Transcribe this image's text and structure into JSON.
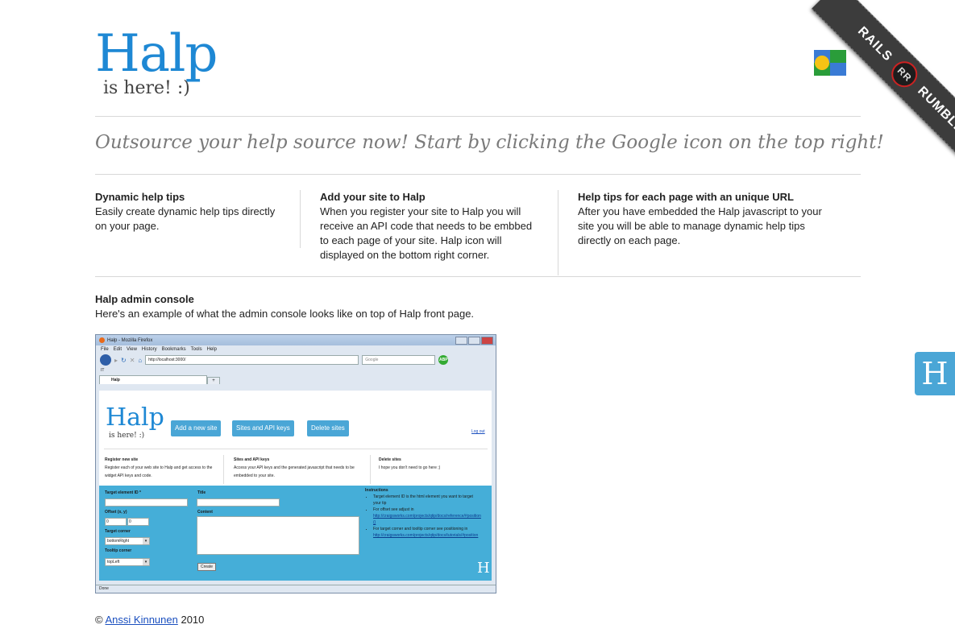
{
  "header": {
    "logo": "Halp",
    "logo_sub": "is here! :)"
  },
  "tagline": "Outsource your help source now! Start by clicking the Google icon on the top right!",
  "features": [
    {
      "title": "Dynamic help tips",
      "body": "Easily create dynamic help tips directly on your page."
    },
    {
      "title": "Add your site to Halp",
      "body": "When you register your site to Halp you will receive an API code that needs to be embbed to each page of your site. Halp icon will displayed on the bottom right corner."
    },
    {
      "title": "Help tips for each page with an unique URL",
      "body": "After you have embedded the Halp javascript to your site you will be able to manage dynamic help tips directly on each page."
    }
  ],
  "admin": {
    "title": "Halp admin console",
    "body": "Here's an example of what the admin console looks like on top of Halp front page."
  },
  "ribbon": {
    "left": "RAILS",
    "badge": "RR",
    "right": "RUMBLE"
  },
  "help_tab": "H",
  "footer": {
    "copy": "©",
    "author": "Anssi Kinnunen",
    "year": "2010"
  },
  "screenshot": {
    "window_title": "Halp - Mozilla Firefox",
    "menu": [
      "File",
      "Edit",
      "View",
      "History",
      "Bookmarks",
      "Tools",
      "Help"
    ],
    "url": "http://localhost:3000/",
    "search_placeholder": "Google",
    "abp": "ABP",
    "bookmark": "IT",
    "tab": "Halp",
    "tab_add": "+",
    "logo": "Halp",
    "logo_sub": "is here! :)",
    "buttons": [
      "Add a new site",
      "Sites and API keys",
      "Delete sites"
    ],
    "logout": "Log out",
    "cols": [
      {
        "title": "Register new site",
        "body": "Register each of your web site to Halp and get access to the widget API keys and code."
      },
      {
        "title": "Sites and API keys",
        "body": "Access your API keys and the generated javascript that needs to be embedded to your site."
      },
      {
        "title": "Delete sites",
        "body": "I hope you don't need to go here ;)"
      }
    ],
    "form": {
      "target_label": "Target element ID *",
      "offset_label": "Offset (x, y)",
      "offset_x": "0",
      "offset_y": "0",
      "corner_label": "Target corner",
      "corner_value": "bottomRight",
      "tooltip_label": "Tooltip corner",
      "tooltip_value": "topLeft",
      "title_label": "Title",
      "content_label": "Content",
      "create": "Create"
    },
    "instructions": {
      "title": "Instructions",
      "item1": "Target element ID is the html element you want to target your tip",
      "item2_text": "For offset see adjust in",
      "item2_link": "http://craigsworks.com/projects/qtip/docs/reference/#position ()",
      "item3_text": "For target corner and tooltip corner see positioning in",
      "item3_link": "http://craigsworks.com/projects/qtip/docs/tutorials/#position"
    },
    "status": "Done"
  }
}
